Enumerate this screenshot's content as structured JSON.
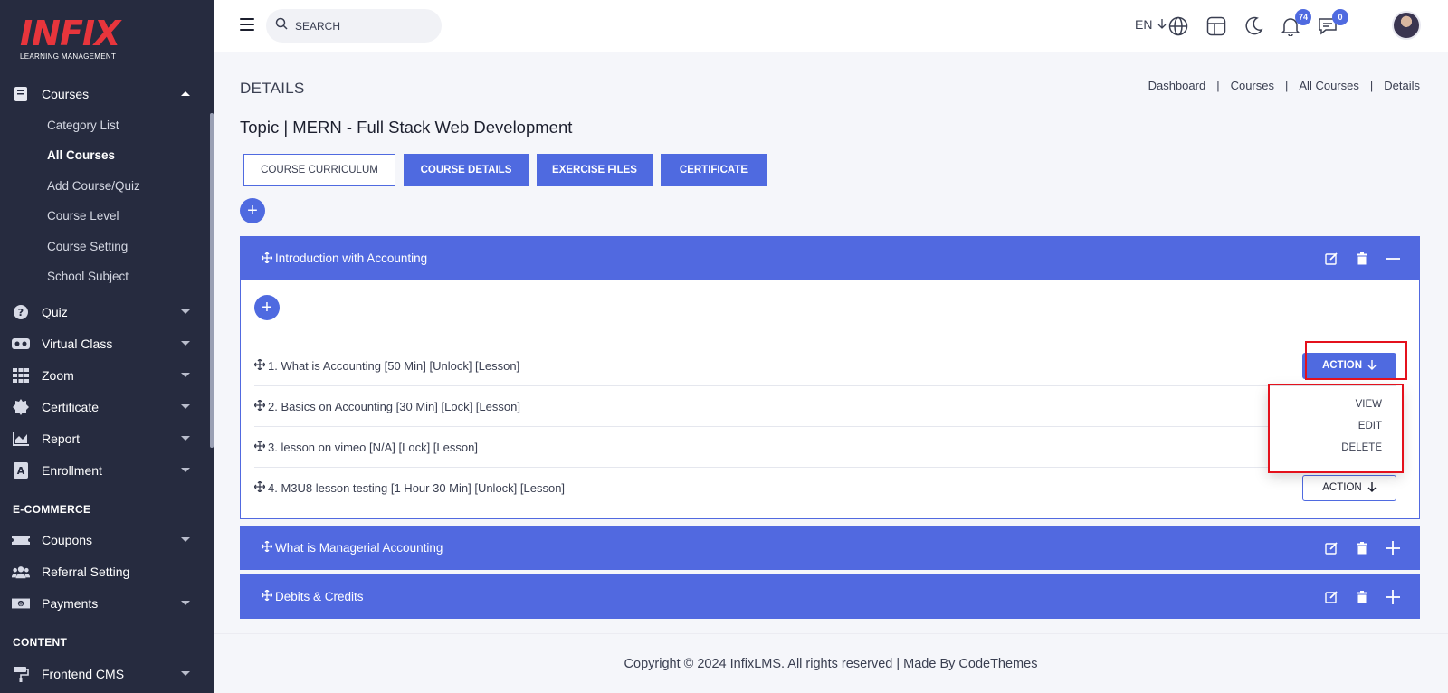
{
  "logo": {
    "brand": "INFIX",
    "subtitle": "LEARNING MANAGEMENT"
  },
  "sidebar": {
    "courses_label": "Courses",
    "sub_items": [
      "Category List",
      "All Courses",
      "Add Course/Quiz",
      "Course Level",
      "Course Setting",
      "School Subject"
    ],
    "active_sub_item": "All Courses",
    "items": [
      {
        "label": "Quiz",
        "icon": "question-circle-icon"
      },
      {
        "label": "Virtual Class",
        "icon": "vr-headset-icon"
      },
      {
        "label": "Zoom",
        "icon": "grid-icon"
      },
      {
        "label": "Certificate",
        "icon": "certificate-seal-icon"
      },
      {
        "label": "Report",
        "icon": "area-chart-icon"
      },
      {
        "label": "Enrollment",
        "icon": "enrollment-icon"
      }
    ],
    "ecommerce_label": "E-COMMERCE",
    "ecommerce_items": [
      {
        "label": "Coupons",
        "icon": "ticket-icon"
      },
      {
        "label": "Referral Setting",
        "icon": "users-icon"
      },
      {
        "label": "Payments",
        "icon": "money-icon"
      }
    ],
    "content_label": "CONTENT",
    "content_items": [
      {
        "label": "Frontend CMS",
        "icon": "paint-roller-icon"
      }
    ]
  },
  "topbar": {
    "search_placeholder": "SEARCH",
    "language": "EN",
    "notification_count": "74",
    "message_count": "0"
  },
  "page": {
    "heading": "DETAILS",
    "breadcrumb": [
      "Dashboard",
      "Courses",
      "All Courses",
      "Details"
    ],
    "topic_title": "Topic | MERN - Full Stack Web Development",
    "tabs": [
      "COURSE CURRICULUM",
      "COURSE DETAILS",
      "EXERCISE FILES",
      "CERTIFICATE"
    ],
    "active_tab": "COURSE CURRICULUM"
  },
  "chapters": [
    {
      "title": "Introduction with Accounting",
      "expanded": true,
      "lessons": [
        "1. What is Accounting [50 Min] [Unlock] [Lesson]",
        "2. Basics on Accounting [30 Min] [Lock] [Lesson]",
        "3. lesson on vimeo [N/A] [Lock] [Lesson]",
        "4. M3U8 lesson testing [1 Hour 30 Min] [Unlock] [Lesson]"
      ]
    },
    {
      "title": "What is Managerial Accounting",
      "expanded": false
    },
    {
      "title": "Debits & Credits",
      "expanded": false
    }
  ],
  "action": {
    "label": "ACTION",
    "menu": [
      "VIEW",
      "EDIT",
      "DELETE"
    ]
  },
  "footer": {
    "text": "Copyright © 2024 InfixLMS. All rights reserved | Made By CodeThemes"
  },
  "colors": {
    "primary": "#5169e0",
    "sidebar_bg": "#262b3f",
    "logo_red": "#e8353c",
    "highlight_red": "#e4111c"
  }
}
